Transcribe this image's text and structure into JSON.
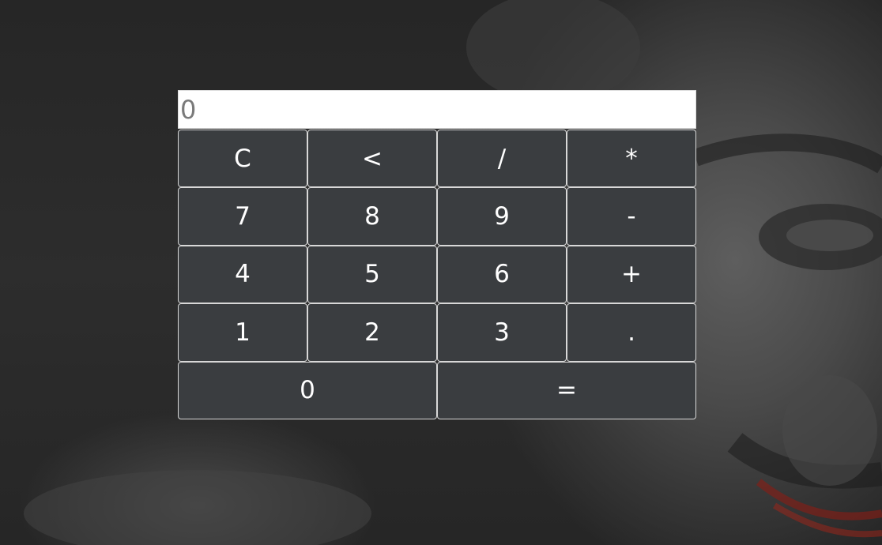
{
  "calculator": {
    "display_value": "0",
    "keys": [
      {
        "label": "C",
        "name": "clear-button"
      },
      {
        "label": "<",
        "name": "backspace-button"
      },
      {
        "label": "/",
        "name": "divide-button"
      },
      {
        "label": "*",
        "name": "multiply-button"
      },
      {
        "label": "7",
        "name": "digit-7-button"
      },
      {
        "label": "8",
        "name": "digit-8-button"
      },
      {
        "label": "9",
        "name": "digit-9-button"
      },
      {
        "label": "-",
        "name": "subtract-button"
      },
      {
        "label": "4",
        "name": "digit-4-button"
      },
      {
        "label": "5",
        "name": "digit-5-button"
      },
      {
        "label": "6",
        "name": "digit-6-button"
      },
      {
        "label": "+",
        "name": "add-button"
      },
      {
        "label": "1",
        "name": "digit-1-button"
      },
      {
        "label": "2",
        "name": "digit-2-button"
      },
      {
        "label": "3",
        "name": "digit-3-button"
      },
      {
        "label": ".",
        "name": "decimal-button"
      },
      {
        "label": "0",
        "name": "digit-0-button"
      },
      {
        "label": "=",
        "name": "equals-button"
      }
    ]
  },
  "colors": {
    "key_background": "#3a3d40",
    "key_text": "#ffffff",
    "key_border": "#d8d8d8",
    "display_background": "#ffffff",
    "display_text": "#7a7a7a"
  }
}
